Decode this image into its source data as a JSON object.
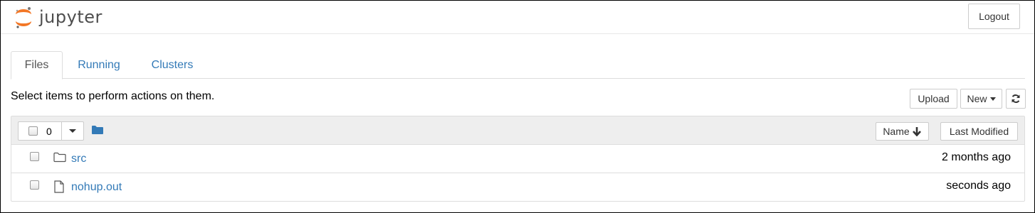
{
  "header": {
    "app_name": "jupyter",
    "logout_label": "Logout"
  },
  "tabs": [
    {
      "label": "Files",
      "active": true
    },
    {
      "label": "Running",
      "active": false
    },
    {
      "label": "Clusters",
      "active": false
    }
  ],
  "toolbar": {
    "instruction": "Select items to perform actions on them.",
    "upload_label": "Upload",
    "new_label": "New",
    "refresh_icon": "refresh-icon"
  },
  "list_header": {
    "selected_count": "0",
    "folder_icon": "folder-icon",
    "sort_name_label": "Name",
    "sort_name_icon": "arrow-down-icon",
    "sort_modified_label": "Last Modified"
  },
  "items": [
    {
      "name": "src",
      "type": "folder",
      "icon": "folder-icon",
      "modified": "2 months ago"
    },
    {
      "name": "nohup.out",
      "type": "file",
      "icon": "file-icon",
      "modified": "seconds ago"
    }
  ],
  "colors": {
    "link": "#337ab7",
    "logo_orange": "#f37726",
    "header_bg": "#eeeeee",
    "border": "#dddddd"
  }
}
